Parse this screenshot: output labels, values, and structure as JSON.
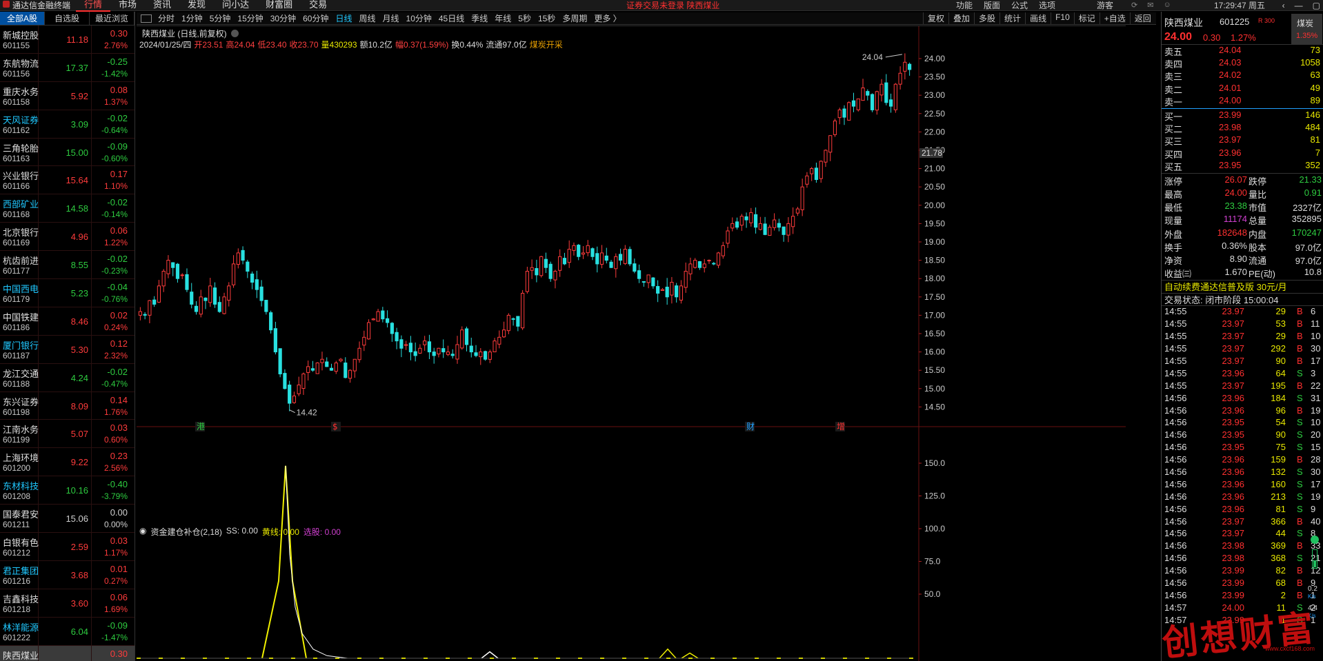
{
  "app": {
    "title": "通达信金融终端",
    "menu": [
      "行情",
      "市场",
      "资讯",
      "发现",
      "问小达",
      "财富圈",
      "交易"
    ],
    "active_menu": "行情",
    "notice": "证券交易未登录  陕西煤业",
    "right_menu": [
      "功能",
      "版面",
      "公式",
      "选项"
    ],
    "guest": "游客",
    "clock": "17:29:47 周五"
  },
  "left_tabs": [
    "全部A股",
    "自选股",
    "最近浏览"
  ],
  "stock_list": [
    {
      "name": "新城控股",
      "code": "601155",
      "price": "11.18",
      "chg": "0.30",
      "pct": "2.76%",
      "dir": "up",
      "special": false
    },
    {
      "name": "东航物流",
      "code": "601156",
      "price": "17.37",
      "chg": "-0.25",
      "pct": "-1.42%",
      "dir": "down",
      "special": false
    },
    {
      "name": "重庆水务",
      "code": "601158",
      "price": "5.92",
      "chg": "0.08",
      "pct": "1.37%",
      "dir": "up",
      "special": false
    },
    {
      "name": "天风证券",
      "code": "601162",
      "price": "3.09",
      "chg": "-0.02",
      "pct": "-0.64%",
      "dir": "down",
      "special": true
    },
    {
      "name": "三角轮胎",
      "code": "601163",
      "price": "15.00",
      "chg": "-0.09",
      "pct": "-0.60%",
      "dir": "down",
      "special": false
    },
    {
      "name": "兴业银行",
      "code": "601166",
      "price": "15.64",
      "chg": "0.17",
      "pct": "1.10%",
      "dir": "up",
      "special": false
    },
    {
      "name": "西部矿业",
      "code": "601168",
      "price": "14.58",
      "chg": "-0.02",
      "pct": "-0.14%",
      "dir": "down",
      "special": true
    },
    {
      "name": "北京银行",
      "code": "601169",
      "price": "4.96",
      "chg": "0.06",
      "pct": "1.22%",
      "dir": "up",
      "special": false
    },
    {
      "name": "杭齿前进",
      "code": "601177",
      "price": "8.55",
      "chg": "-0.02",
      "pct": "-0.23%",
      "dir": "down",
      "special": false
    },
    {
      "name": "中国西电",
      "code": "601179",
      "price": "5.23",
      "chg": "-0.04",
      "pct": "-0.76%",
      "dir": "down",
      "special": true
    },
    {
      "name": "中国铁建",
      "code": "601186",
      "price": "8.46",
      "chg": "0.02",
      "pct": "0.24%",
      "dir": "up",
      "special": false
    },
    {
      "name": "厦门银行",
      "code": "601187",
      "price": "5.30",
      "chg": "0.12",
      "pct": "2.32%",
      "dir": "up",
      "special": true
    },
    {
      "name": "龙江交通",
      "code": "601188",
      "price": "4.24",
      "chg": "-0.02",
      "pct": "-0.47%",
      "dir": "down",
      "special": false
    },
    {
      "name": "东兴证券",
      "code": "601198",
      "price": "8.09",
      "chg": "0.14",
      "pct": "1.76%",
      "dir": "up",
      "special": false
    },
    {
      "name": "江南水务",
      "code": "601199",
      "price": "5.07",
      "chg": "0.03",
      "pct": "0.60%",
      "dir": "up",
      "special": false
    },
    {
      "name": "上海环境",
      "code": "601200",
      "price": "9.22",
      "chg": "0.23",
      "pct": "2.56%",
      "dir": "up",
      "special": false
    },
    {
      "name": "东材科技",
      "code": "601208",
      "price": "10.16",
      "chg": "-0.40",
      "pct": "-3.79%",
      "dir": "down",
      "special": true
    },
    {
      "name": "国泰君安",
      "code": "601211",
      "price": "15.06",
      "chg": "0.00",
      "pct": "0.00%",
      "dir": "flat",
      "special": false
    },
    {
      "name": "白银有色",
      "code": "601212",
      "price": "2.59",
      "chg": "0.03",
      "pct": "1.17%",
      "dir": "up",
      "special": false
    },
    {
      "name": "君正集团",
      "code": "601216",
      "price": "3.68",
      "chg": "0.01",
      "pct": "0.27%",
      "dir": "up",
      "special": true
    },
    {
      "name": "吉鑫科技",
      "code": "601218",
      "price": "3.60",
      "chg": "0.06",
      "pct": "1.69%",
      "dir": "up",
      "special": false
    },
    {
      "name": "林洋能源",
      "code": "601222",
      "price": "6.04",
      "chg": "-0.09",
      "pct": "-1.47%",
      "dir": "down",
      "special": true
    },
    {
      "name": "陕西煤业",
      "code": "",
      "price": "",
      "chg": "0.30",
      "pct": "",
      "dir": "up",
      "special": false,
      "current": true
    }
  ],
  "periods": [
    "分时",
    "1分钟",
    "5分钟",
    "15分钟",
    "30分钟",
    "60分钟",
    "日线",
    "周线",
    "月线",
    "10分钟",
    "45日线",
    "季线",
    "年线",
    "5秒",
    "15秒",
    "多周期",
    "更多 〉"
  ],
  "active_period": "日线",
  "tools": [
    "复权",
    "叠加",
    "多股",
    "统计",
    "画线",
    "F10",
    "标记",
    "+自选",
    "返回"
  ],
  "chart_header": {
    "title": "陕西煤业 (日线,前复权)",
    "date": "2024/01/25/四",
    "open": "开23.51",
    "high": "高24.04",
    "low": "低23.40",
    "close": "收23.70",
    "vol": "量430293",
    "amount": "额10.2亿",
    "range": "幅0.37(1.59%)",
    "turnover": "换0.44%",
    "float": "流通97.0亿",
    "concept": "煤炭开采"
  },
  "indicator_header": {
    "name": "资金建仓补仓(2,18)",
    "ss": "SS: 0.00",
    "yellow": "黄线: 0.00",
    "pick": "选股: 0.00"
  },
  "chart_data": {
    "type": "candlestick",
    "price_axis": {
      "min": 14.0,
      "max": 24.3,
      "ticks": [
        "24.00",
        "23.50",
        "23.00",
        "22.50",
        "22.00",
        "21.50",
        "21.00",
        "20.50",
        "20.00",
        "19.50",
        "19.00",
        "18.50",
        "18.00",
        "17.50",
        "17.00",
        "16.50",
        "16.00",
        "15.50",
        "15.00",
        "14.50"
      ]
    },
    "current_price_label": "21.78",
    "high_marker": "24.04",
    "low_marker": "14.42",
    "event_markers": [
      {
        "label": "港",
        "color": "#2ecc40"
      },
      {
        "label": "$",
        "color": "#ff3030"
      },
      {
        "label": "财",
        "color": "#20a0ff"
      },
      {
        "label": "增",
        "color": "#ff3030"
      }
    ],
    "closes": [
      17.1,
      17.0,
      17.4,
      17.3,
      17.8,
      18.2,
      18.5,
      18.3,
      18.0,
      18.1,
      17.7,
      17.3,
      17.1,
      17.5,
      17.4,
      17.8,
      17.3,
      17.1,
      17.5,
      17.8,
      18.4,
      18.7,
      18.5,
      18.2,
      17.9,
      17.7,
      17.4,
      17.1,
      16.6,
      16.0,
      15.4,
      15.0,
      14.6,
      14.8,
      15.1,
      15.4,
      15.6,
      15.5,
      15.7,
      15.8,
      15.6,
      15.5,
      15.7,
      15.8,
      15.3,
      15.5,
      15.8,
      16.1,
      16.4,
      16.8,
      16.9,
      17.1,
      16.9,
      16.8,
      16.5,
      16.3,
      16.1,
      16.2,
      16.0,
      15.9,
      16.1,
      16.3,
      16.0,
      15.9,
      16.1,
      16.0,
      16.0,
      15.9,
      16.2,
      16.6,
      16.2,
      16.0,
      15.9,
      16.0,
      15.8,
      16.0,
      16.3,
      16.4,
      16.6,
      17.0,
      16.9,
      16.7,
      17.6,
      18.2,
      18.3,
      18.1,
      18.6,
      18.3,
      18.0,
      18.2,
      18.6,
      18.4,
      18.8,
      18.9,
      18.6,
      18.7,
      18.9,
      18.6,
      18.4,
      18.7,
      18.5,
      18.3,
      18.6,
      18.5,
      18.8,
      18.4,
      18.2,
      18.0,
      17.9,
      18.1,
      17.8,
      17.6,
      17.7,
      17.5,
      17.9,
      17.5,
      17.8,
      18.2,
      18.4,
      18.5,
      18.3,
      18.4,
      18.5,
      18.4,
      18.7,
      18.9,
      19.3,
      19.5,
      19.4,
      19.7,
      19.6,
      19.8,
      19.4,
      19.5,
      19.2,
      19.4,
      19.6,
      19.4,
      19.2,
      19.5,
      19.7,
      19.9,
      20.5,
      20.8,
      21.0,
      20.7,
      21.2,
      21.5,
      21.9,
      22.3,
      22.6,
      22.4,
      22.8,
      22.7,
      22.9,
      23.2,
      23.0,
      22.6,
      23.1,
      23.3,
      22.8,
      22.7,
      23.3,
      23.6,
      23.9,
      23.7
    ],
    "indicator_axis": {
      "min": 0,
      "max": 160,
      "ticks": [
        "150.0",
        "125.0",
        "100.0",
        "75.0",
        "50.0"
      ]
    }
  },
  "quote": {
    "name": "陕西煤业",
    "code": "601225",
    "rtag": "R 300",
    "price": "24.00",
    "chg": "0.30",
    "pct": "1.27%",
    "industry": "煤炭",
    "industry_pct": "1.35%",
    "sell": [
      {
        "l": "卖五",
        "p": "24.04",
        "v": "73"
      },
      {
        "l": "卖四",
        "p": "24.03",
        "v": "1058"
      },
      {
        "l": "卖三",
        "p": "24.02",
        "v": "63"
      },
      {
        "l": "卖二",
        "p": "24.01",
        "v": "49"
      },
      {
        "l": "卖一",
        "p": "24.00",
        "v": "89"
      }
    ],
    "buy": [
      {
        "l": "买一",
        "p": "23.99",
        "v": "146"
      },
      {
        "l": "买二",
        "p": "23.98",
        "v": "484"
      },
      {
        "l": "买三",
        "p": "23.97",
        "v": "81"
      },
      {
        "l": "买四",
        "p": "23.96",
        "v": "7"
      },
      {
        "l": "买五",
        "p": "23.95",
        "v": "352"
      }
    ],
    "stats": [
      {
        "l1": "涨停",
        "v1": "26.07",
        "c1": "up",
        "l2": "跌停",
        "v2": "21.33",
        "c2": "down"
      },
      {
        "l1": "最高",
        "v1": "24.00",
        "c1": "up",
        "l2": "量比",
        "v2": "0.91",
        "c2": "down"
      },
      {
        "l1": "最低",
        "v1": "23.38",
        "c1": "down",
        "l2": "市值",
        "v2": "2327亿",
        "c2": "w"
      },
      {
        "l1": "现量",
        "v1": "11174",
        "c1": "m",
        "l2": "总量",
        "v2": "352895",
        "c2": "w"
      },
      {
        "l1": "外盘",
        "v1": "182648",
        "c1": "up",
        "l2": "内盘",
        "v2": "170247",
        "c2": "down"
      },
      {
        "l1": "换手",
        "v1": "0.36%",
        "c1": "w",
        "l2": "股本",
        "v2": "97.0亿",
        "c2": "w"
      },
      {
        "l1": "净资",
        "v1": "8.90",
        "c1": "w",
        "l2": "流通",
        "v2": "97.0亿",
        "c2": "w"
      },
      {
        "l1": "收益㈢",
        "v1": "1.670",
        "c1": "w",
        "l2": "PE(动)",
        "v2": "10.8",
        "c2": "w"
      }
    ],
    "promo": "自动续费通达信普及版  30元/月",
    "trade_status": "交易状态: 闭市阶段 15:00:04",
    "ticks": [
      {
        "t": "14:55",
        "p": "23.97",
        "v": "29",
        "bs": "B",
        "n": "6"
      },
      {
        "t": "14:55",
        "p": "23.97",
        "v": "53",
        "bs": "B",
        "n": "11"
      },
      {
        "t": "14:55",
        "p": "23.97",
        "v": "29",
        "bs": "B",
        "n": "10"
      },
      {
        "t": "14:55",
        "p": "23.97",
        "v": "292",
        "bs": "B",
        "n": "30"
      },
      {
        "t": "14:55",
        "p": "23.97",
        "v": "90",
        "bs": "B",
        "n": "17"
      },
      {
        "t": "14:55",
        "p": "23.96",
        "v": "64",
        "bs": "S",
        "n": "3"
      },
      {
        "t": "14:55",
        "p": "23.97",
        "v": "195",
        "bs": "B",
        "n": "22"
      },
      {
        "t": "14:56",
        "p": "23.96",
        "v": "184",
        "bs": "S",
        "n": "31"
      },
      {
        "t": "14:56",
        "p": "23.96",
        "v": "96",
        "bs": "B",
        "n": "19"
      },
      {
        "t": "14:56",
        "p": "23.95",
        "v": "54",
        "bs": "S",
        "n": "10"
      },
      {
        "t": "14:56",
        "p": "23.95",
        "v": "90",
        "bs": "S",
        "n": "20"
      },
      {
        "t": "14:56",
        "p": "23.95",
        "v": "75",
        "bs": "S",
        "n": "15"
      },
      {
        "t": "14:56",
        "p": "23.96",
        "v": "159",
        "bs": "B",
        "n": "28"
      },
      {
        "t": "14:56",
        "p": "23.96",
        "v": "132",
        "bs": "S",
        "n": "30"
      },
      {
        "t": "14:56",
        "p": "23.96",
        "v": "160",
        "bs": "S",
        "n": "17"
      },
      {
        "t": "14:56",
        "p": "23.96",
        "v": "213",
        "bs": "S",
        "n": "19"
      },
      {
        "t": "14:56",
        "p": "23.96",
        "v": "81",
        "bs": "S",
        "n": "9"
      },
      {
        "t": "14:56",
        "p": "23.97",
        "v": "366",
        "bs": "B",
        "n": "40"
      },
      {
        "t": "14:56",
        "p": "23.97",
        "v": "44",
        "bs": "S",
        "n": "8"
      },
      {
        "t": "14:56",
        "p": "23.98",
        "v": "369",
        "bs": "B",
        "n": "33"
      },
      {
        "t": "14:56",
        "p": "23.98",
        "v": "368",
        "bs": "S",
        "n": "21"
      },
      {
        "t": "14:56",
        "p": "23.99",
        "v": "82",
        "bs": "B",
        "n": "12"
      },
      {
        "t": "14:56",
        "p": "23.99",
        "v": "68",
        "bs": "B",
        "n": "9"
      },
      {
        "t": "14:56",
        "p": "23.99",
        "v": "2",
        "bs": "B",
        "n": "1"
      },
      {
        "t": "14:57",
        "p": "24.00",
        "v": "11",
        "bs": "S",
        "n": "2"
      },
      {
        "t": "14:57",
        "p": "23.99",
        "v": "1",
        "bs": "S",
        "n": "1"
      }
    ],
    "net": {
      "up": "0.2",
      "up_unit": "K/s",
      "down": "4.4",
      "down_unit": "K/s"
    }
  },
  "watermark": {
    "text": "创想财富",
    "url": "www.cxcf168.com"
  }
}
